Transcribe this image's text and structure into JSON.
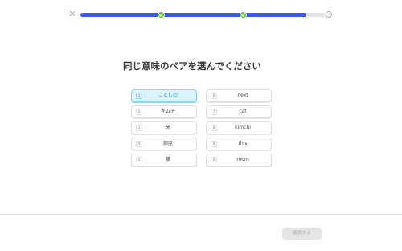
{
  "header": {
    "close_icon": "close-icon",
    "close_glyph": "✕",
    "progress_fraction": 0.92,
    "checkpoint_fractions": [
      0.33,
      0.665
    ],
    "checkpoint_icon": "check-icon",
    "end_icon": "trophy-icon",
    "colors": {
      "fill": "#3b5be0",
      "checkpoint": "#58cc02",
      "track": "#e5e5e5"
    }
  },
  "prompt": "同じ意味のペアを選んでください",
  "cards": {
    "left": [
      {
        "num": "1",
        "text": "ことしの",
        "selected": true
      },
      {
        "num": "2",
        "text": "キムチ",
        "selected": false
      },
      {
        "num": "3",
        "text": "来",
        "selected": false
      },
      {
        "num": "4",
        "text": "部屋",
        "selected": false
      },
      {
        "num": "5",
        "text": "猫",
        "selected": false
      }
    ],
    "right": [
      {
        "num": "6",
        "text": "next",
        "selected": false
      },
      {
        "num": "7",
        "text": "cat",
        "selected": false
      },
      {
        "num": "8",
        "text": "kimchi",
        "selected": false
      },
      {
        "num": "9",
        "text": "this",
        "selected": false
      },
      {
        "num": "0",
        "text": "room",
        "selected": false
      }
    ]
  },
  "footer": {
    "submit_label": "確認する",
    "submit_enabled": false,
    "colors": {
      "selected_bg": "#ddf4ff",
      "selected_border": "#84d8ff",
      "selected_text": "#1899d6"
    }
  }
}
